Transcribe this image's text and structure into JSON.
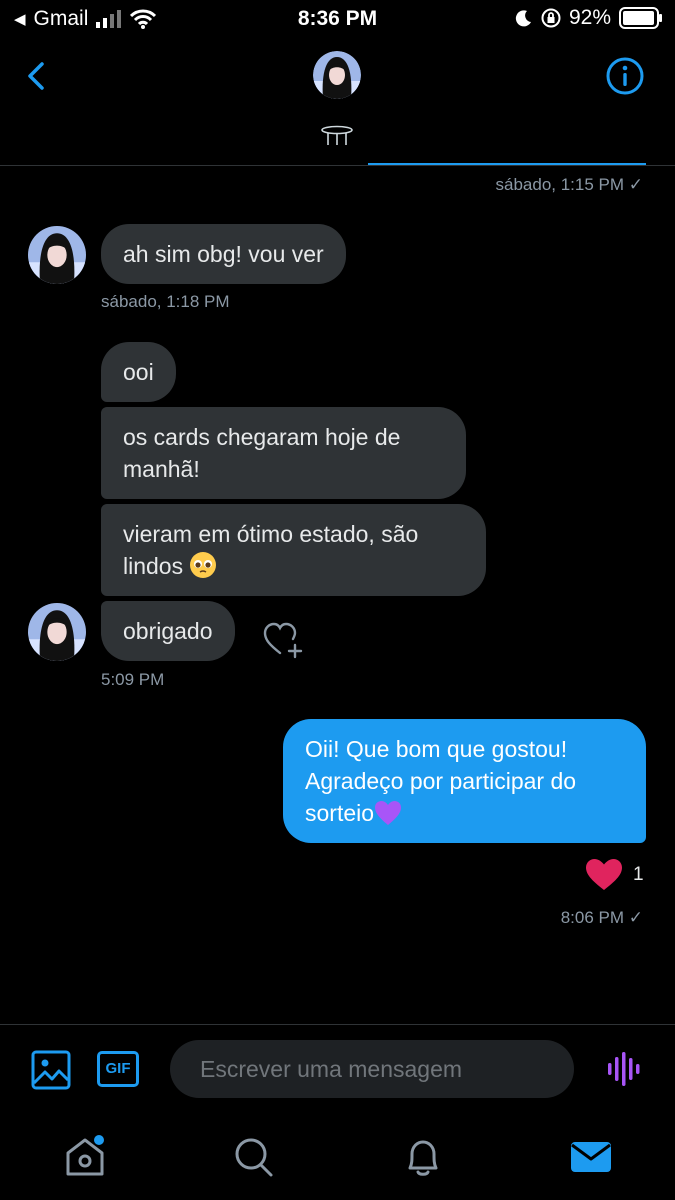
{
  "status_bar": {
    "back_app": "Gmail",
    "time": "8:36 PM",
    "battery": "92%"
  },
  "header": {
    "back_icon": "chevron-left-icon",
    "info_icon": "info-circle-icon"
  },
  "messages": [
    {
      "direction": "outgoing",
      "timestamp": "sábado, 1:15 PM ✓"
    },
    {
      "direction": "incoming",
      "text": "ah sim obg! vou ver",
      "timestamp": "sábado, 1:18 PM"
    },
    {
      "direction": "incoming",
      "text": "ooi"
    },
    {
      "direction": "incoming",
      "text_lines": [
        "os cards chegaram hoje de",
        "manhã!"
      ]
    },
    {
      "direction": "incoming",
      "text_lines": [
        "vieram em ótimo estado, são",
        "lindos"
      ],
      "emoji": "pleading-face"
    },
    {
      "direction": "incoming",
      "text": "obrigado",
      "timestamp": "5:09 PM"
    },
    {
      "direction": "outgoing",
      "text_lines": [
        "Oii! Que bom que gostou!",
        "Agradeço por participar do",
        "sorteio"
      ],
      "emoji": "purple-heart",
      "reaction": {
        "icon": "red-heart",
        "count": "1"
      },
      "timestamp": "8:06 PM ✓"
    }
  ],
  "composer": {
    "placeholder": "Escrever uma mensagem",
    "gif_label": "GIF"
  },
  "tabbar": {
    "items": [
      "home-icon",
      "search-icon",
      "notifications-icon",
      "messages-icon"
    ],
    "active": "messages-icon"
  },
  "colors": {
    "accent": "#1d9bf0",
    "incoming_bubble": "#2f3336",
    "voice_icon": "#a855f7",
    "heart": "#e0245e"
  }
}
